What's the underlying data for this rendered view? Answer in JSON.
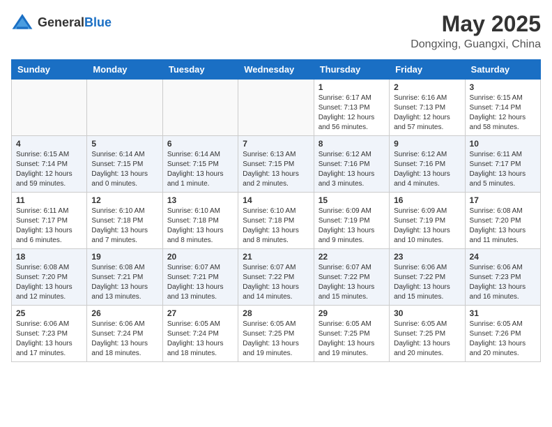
{
  "header": {
    "logo_general": "General",
    "logo_blue": "Blue",
    "month": "May 2025",
    "location": "Dongxing, Guangxi, China"
  },
  "weekdays": [
    "Sunday",
    "Monday",
    "Tuesday",
    "Wednesday",
    "Thursday",
    "Friday",
    "Saturday"
  ],
  "weeks": [
    [
      {
        "day": "",
        "sunrise": "",
        "sunset": "",
        "daylight": "",
        "empty": true
      },
      {
        "day": "",
        "sunrise": "",
        "sunset": "",
        "daylight": "",
        "empty": true
      },
      {
        "day": "",
        "sunrise": "",
        "sunset": "",
        "daylight": "",
        "empty": true
      },
      {
        "day": "",
        "sunrise": "",
        "sunset": "",
        "daylight": "",
        "empty": true
      },
      {
        "day": "1",
        "sunrise": "Sunrise: 6:17 AM",
        "sunset": "Sunset: 7:13 PM",
        "daylight": "Daylight: 12 hours and 56 minutes.",
        "empty": false
      },
      {
        "day": "2",
        "sunrise": "Sunrise: 6:16 AM",
        "sunset": "Sunset: 7:13 PM",
        "daylight": "Daylight: 12 hours and 57 minutes.",
        "empty": false
      },
      {
        "day": "3",
        "sunrise": "Sunrise: 6:15 AM",
        "sunset": "Sunset: 7:14 PM",
        "daylight": "Daylight: 12 hours and 58 minutes.",
        "empty": false
      }
    ],
    [
      {
        "day": "4",
        "sunrise": "Sunrise: 6:15 AM",
        "sunset": "Sunset: 7:14 PM",
        "daylight": "Daylight: 12 hours and 59 minutes.",
        "empty": false
      },
      {
        "day": "5",
        "sunrise": "Sunrise: 6:14 AM",
        "sunset": "Sunset: 7:15 PM",
        "daylight": "Daylight: 13 hours and 0 minutes.",
        "empty": false
      },
      {
        "day": "6",
        "sunrise": "Sunrise: 6:14 AM",
        "sunset": "Sunset: 7:15 PM",
        "daylight": "Daylight: 13 hours and 1 minute.",
        "empty": false
      },
      {
        "day": "7",
        "sunrise": "Sunrise: 6:13 AM",
        "sunset": "Sunset: 7:15 PM",
        "daylight": "Daylight: 13 hours and 2 minutes.",
        "empty": false
      },
      {
        "day": "8",
        "sunrise": "Sunrise: 6:12 AM",
        "sunset": "Sunset: 7:16 PM",
        "daylight": "Daylight: 13 hours and 3 minutes.",
        "empty": false
      },
      {
        "day": "9",
        "sunrise": "Sunrise: 6:12 AM",
        "sunset": "Sunset: 7:16 PM",
        "daylight": "Daylight: 13 hours and 4 minutes.",
        "empty": false
      },
      {
        "day": "10",
        "sunrise": "Sunrise: 6:11 AM",
        "sunset": "Sunset: 7:17 PM",
        "daylight": "Daylight: 13 hours and 5 minutes.",
        "empty": false
      }
    ],
    [
      {
        "day": "11",
        "sunrise": "Sunrise: 6:11 AM",
        "sunset": "Sunset: 7:17 PM",
        "daylight": "Daylight: 13 hours and 6 minutes.",
        "empty": false
      },
      {
        "day": "12",
        "sunrise": "Sunrise: 6:10 AM",
        "sunset": "Sunset: 7:18 PM",
        "daylight": "Daylight: 13 hours and 7 minutes.",
        "empty": false
      },
      {
        "day": "13",
        "sunrise": "Sunrise: 6:10 AM",
        "sunset": "Sunset: 7:18 PM",
        "daylight": "Daylight: 13 hours and 8 minutes.",
        "empty": false
      },
      {
        "day": "14",
        "sunrise": "Sunrise: 6:10 AM",
        "sunset": "Sunset: 7:18 PM",
        "daylight": "Daylight: 13 hours and 8 minutes.",
        "empty": false
      },
      {
        "day": "15",
        "sunrise": "Sunrise: 6:09 AM",
        "sunset": "Sunset: 7:19 PM",
        "daylight": "Daylight: 13 hours and 9 minutes.",
        "empty": false
      },
      {
        "day": "16",
        "sunrise": "Sunrise: 6:09 AM",
        "sunset": "Sunset: 7:19 PM",
        "daylight": "Daylight: 13 hours and 10 minutes.",
        "empty": false
      },
      {
        "day": "17",
        "sunrise": "Sunrise: 6:08 AM",
        "sunset": "Sunset: 7:20 PM",
        "daylight": "Daylight: 13 hours and 11 minutes.",
        "empty": false
      }
    ],
    [
      {
        "day": "18",
        "sunrise": "Sunrise: 6:08 AM",
        "sunset": "Sunset: 7:20 PM",
        "daylight": "Daylight: 13 hours and 12 minutes.",
        "empty": false
      },
      {
        "day": "19",
        "sunrise": "Sunrise: 6:08 AM",
        "sunset": "Sunset: 7:21 PM",
        "daylight": "Daylight: 13 hours and 13 minutes.",
        "empty": false
      },
      {
        "day": "20",
        "sunrise": "Sunrise: 6:07 AM",
        "sunset": "Sunset: 7:21 PM",
        "daylight": "Daylight: 13 hours and 13 minutes.",
        "empty": false
      },
      {
        "day": "21",
        "sunrise": "Sunrise: 6:07 AM",
        "sunset": "Sunset: 7:22 PM",
        "daylight": "Daylight: 13 hours and 14 minutes.",
        "empty": false
      },
      {
        "day": "22",
        "sunrise": "Sunrise: 6:07 AM",
        "sunset": "Sunset: 7:22 PM",
        "daylight": "Daylight: 13 hours and 15 minutes.",
        "empty": false
      },
      {
        "day": "23",
        "sunrise": "Sunrise: 6:06 AM",
        "sunset": "Sunset: 7:22 PM",
        "daylight": "Daylight: 13 hours and 15 minutes.",
        "empty": false
      },
      {
        "day": "24",
        "sunrise": "Sunrise: 6:06 AM",
        "sunset": "Sunset: 7:23 PM",
        "daylight": "Daylight: 13 hours and 16 minutes.",
        "empty": false
      }
    ],
    [
      {
        "day": "25",
        "sunrise": "Sunrise: 6:06 AM",
        "sunset": "Sunset: 7:23 PM",
        "daylight": "Daylight: 13 hours and 17 minutes.",
        "empty": false
      },
      {
        "day": "26",
        "sunrise": "Sunrise: 6:06 AM",
        "sunset": "Sunset: 7:24 PM",
        "daylight": "Daylight: 13 hours and 18 minutes.",
        "empty": false
      },
      {
        "day": "27",
        "sunrise": "Sunrise: 6:05 AM",
        "sunset": "Sunset: 7:24 PM",
        "daylight": "Daylight: 13 hours and 18 minutes.",
        "empty": false
      },
      {
        "day": "28",
        "sunrise": "Sunrise: 6:05 AM",
        "sunset": "Sunset: 7:25 PM",
        "daylight": "Daylight: 13 hours and 19 minutes.",
        "empty": false
      },
      {
        "day": "29",
        "sunrise": "Sunrise: 6:05 AM",
        "sunset": "Sunset: 7:25 PM",
        "daylight": "Daylight: 13 hours and 19 minutes.",
        "empty": false
      },
      {
        "day": "30",
        "sunrise": "Sunrise: 6:05 AM",
        "sunset": "Sunset: 7:25 PM",
        "daylight": "Daylight: 13 hours and 20 minutes.",
        "empty": false
      },
      {
        "day": "31",
        "sunrise": "Sunrise: 6:05 AM",
        "sunset": "Sunset: 7:26 PM",
        "daylight": "Daylight: 13 hours and 20 minutes.",
        "empty": false
      }
    ]
  ]
}
